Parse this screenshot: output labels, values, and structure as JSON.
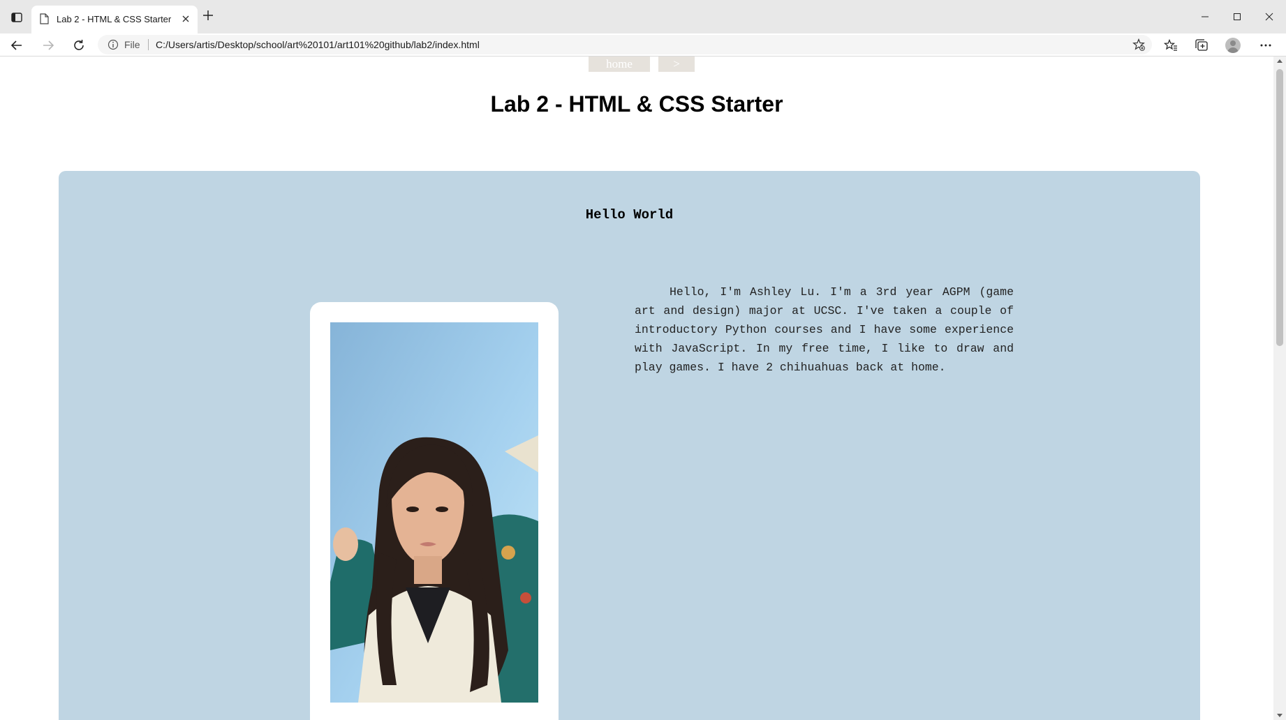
{
  "browser": {
    "tab_title": "Lab 2 - HTML & CSS Starter",
    "scheme_label": "File",
    "url": "C:/Users/artis/Desktop/school/art%20101/art101%20github/lab2/index.html"
  },
  "nav": {
    "home_label": "home",
    "next_label": ">"
  },
  "page": {
    "title": "Lab 2 - HTML & CSS Starter",
    "card_heading": "Hello World",
    "bio": "Hello, I'm Ashley Lu. I'm a 3rd year AGPM (game art and design) major at UCSC. I've taken a couple of introductory Python courses and I have some experience with JavaScript. In my free time, I like to draw and play games. I have 2 chihuahuas back at home."
  },
  "colors": {
    "card_background": "#bfd5e3",
    "nav_background": "#e6e2dc",
    "photo_frame": "#ffffff"
  },
  "icons": {
    "tab_actions": "tab-actions-icon",
    "tab_page": "page-icon",
    "tab_close": "close-icon",
    "new_tab": "plus-icon",
    "back": "back-arrow-icon",
    "forward": "forward-arrow-icon",
    "reload": "reload-icon",
    "site_info": "info-icon",
    "add_favorite": "add-favorite-icon",
    "favorites": "favorites-icon",
    "collections": "collections-icon",
    "profile": "avatar",
    "more": "more-icon",
    "minimize": "minimize-icon",
    "maximize": "maximize-icon",
    "close_window": "close-window-icon"
  }
}
